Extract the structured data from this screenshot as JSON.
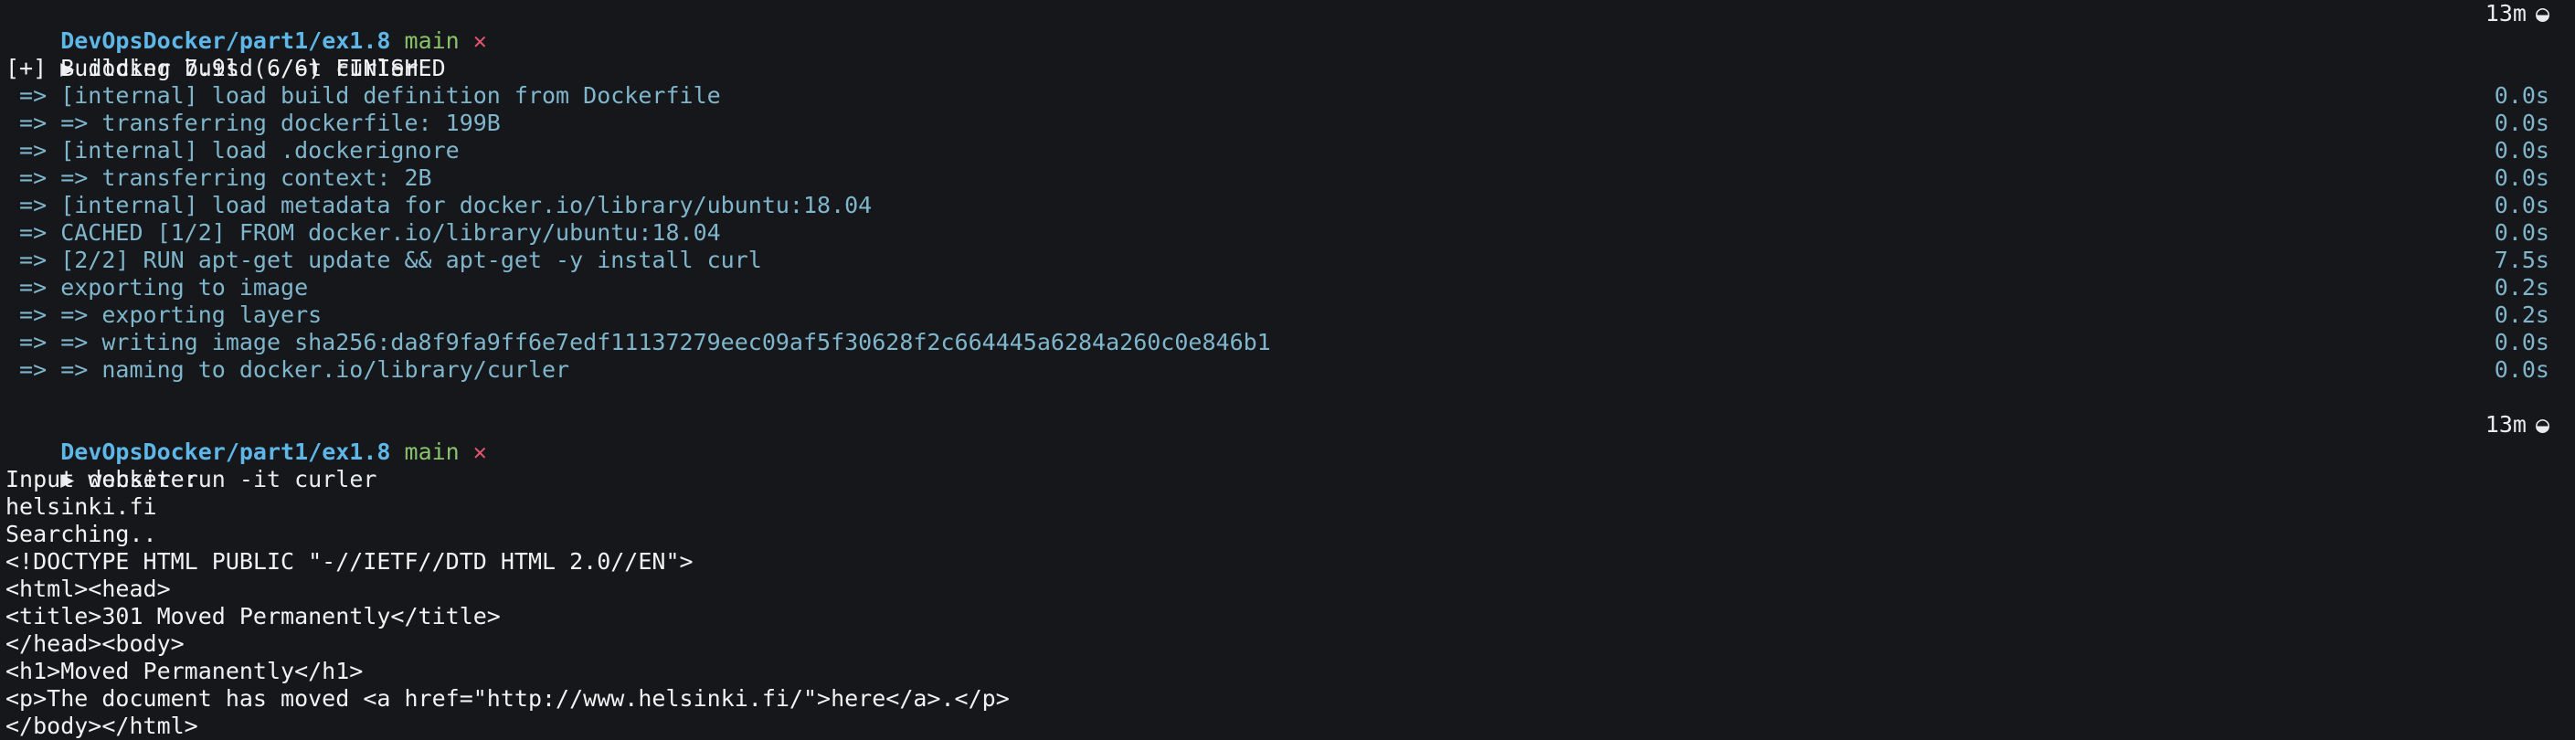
{
  "session1": {
    "prompt": {
      "path": "DevOpsDocker/part1/ex1.8",
      "branch": "main",
      "dirty_mark": "✕",
      "elapsed": "13m",
      "elapsed_icon": "◒"
    },
    "command": "docker build . -t curler",
    "status_line": "[+] Building 7.9s (6/6) FINISHED",
    "steps": [
      {
        "text": " => [internal] load build definition from Dockerfile",
        "time": "0.0s"
      },
      {
        "text": " => => transferring dockerfile: 199B",
        "time": "0.0s"
      },
      {
        "text": " => [internal] load .dockerignore",
        "time": "0.0s"
      },
      {
        "text": " => => transferring context: 2B",
        "time": "0.0s"
      },
      {
        "text": " => [internal] load metadata for docker.io/library/ubuntu:18.04",
        "time": "0.0s"
      },
      {
        "text": " => CACHED [1/2] FROM docker.io/library/ubuntu:18.04",
        "time": "0.0s"
      },
      {
        "text": " => [2/2] RUN apt-get update && apt-get -y install curl",
        "time": "7.5s"
      },
      {
        "text": " => exporting to image",
        "time": "0.2s"
      },
      {
        "text": " => => exporting layers",
        "time": "0.2s"
      },
      {
        "text": " => => writing image sha256:da8f9fa9ff6e7edf11137279eec09af5f30628f2c664445a6284a260c0e846b1",
        "time": "0.0s"
      },
      {
        "text": " => => naming to docker.io/library/curler",
        "time": "0.0s"
      }
    ]
  },
  "session2": {
    "prompt": {
      "path": "DevOpsDocker/part1/ex1.8",
      "branch": "main",
      "dirty_mark": "✕",
      "elapsed": "13m",
      "elapsed_icon": "◒"
    },
    "command": "docker run -it curler",
    "output": [
      "Input website:",
      "helsinki.fi",
      "Searching..",
      "<!DOCTYPE HTML PUBLIC \"-//IETF//DTD HTML 2.0//EN\">",
      "<html><head>",
      "<title>301 Moved Permanently</title>",
      "</head><body>",
      "<h1>Moved Permanently</h1>",
      "<p>The document has moved <a href=\"http://www.helsinki.fi/\">here</a>.</p>",
      "</body></html>"
    ]
  },
  "prompt_symbol": "▶"
}
